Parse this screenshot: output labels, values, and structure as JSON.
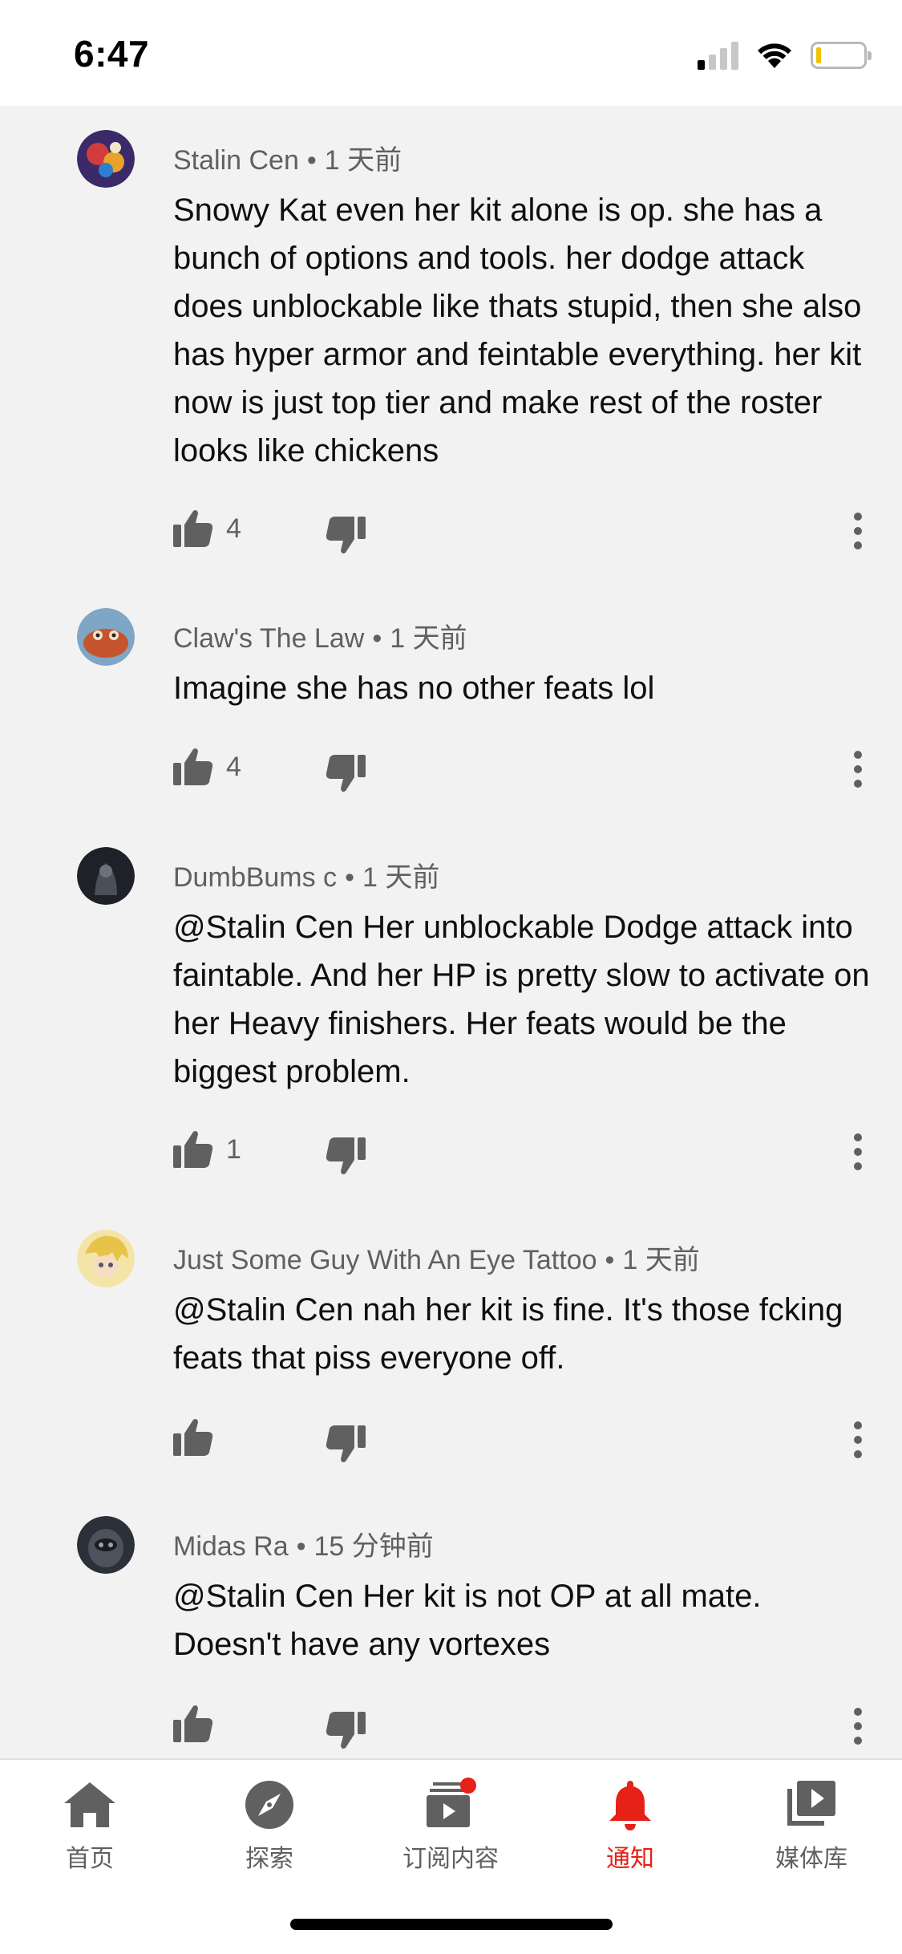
{
  "status_bar": {
    "time": "6:47",
    "battery_level": 0.1,
    "signal_bars": 1
  },
  "comments": [
    {
      "author": "Stalin Cen",
      "separator": "•",
      "time": "1 天前",
      "text": "Snowy Kat even her kit alone is op. she has a bunch of options and tools. her dodge attack does unblockable like thats stupid, then she also has hyper armor and feintable everything. her kit now is just top tier and make rest of the roster looks like chickens",
      "likes": "4",
      "avatar_color": "#7a3b8f"
    },
    {
      "author": "Claw's The Law",
      "separator": "•",
      "time": "1 天前",
      "text": "Imagine she has no other feats lol",
      "likes": "4",
      "avatar_color": "#c4552c"
    },
    {
      "author": "DumbBums c",
      "separator": "•",
      "time": "1 天前",
      "text": "@Stalin Cen Her unblockable Dodge attack into faintable. And her HP is pretty slow to activate on her Heavy finishers. Her feats would be the biggest problem.",
      "likes": "1",
      "avatar_color": "#2a2d33"
    },
    {
      "author": "Just Some Guy With An Eye Tattoo",
      "separator": "•",
      "time": "1 天前",
      "text": "@Stalin Cen nah her kit is fine. It's those fcking feats that piss everyone off.",
      "likes": "",
      "avatar_color": "#e8c96a"
    },
    {
      "author": "Midas Ra",
      "separator": "•",
      "time": "15 分钟前",
      "text": "@Stalin Cen Her kit is not OP at all mate. Doesn't have any vortexes",
      "likes": "",
      "avatar_color": "#3c4048"
    }
  ],
  "bottom_nav": {
    "items": [
      {
        "label": "首页",
        "icon": "home-icon"
      },
      {
        "label": "探索",
        "icon": "explore-icon"
      },
      {
        "label": "订阅内容",
        "icon": "subscriptions-icon"
      },
      {
        "label": "通知",
        "icon": "bell-icon",
        "active": true
      },
      {
        "label": "媒体库",
        "icon": "library-icon"
      }
    ],
    "active_color": "#e62117"
  }
}
